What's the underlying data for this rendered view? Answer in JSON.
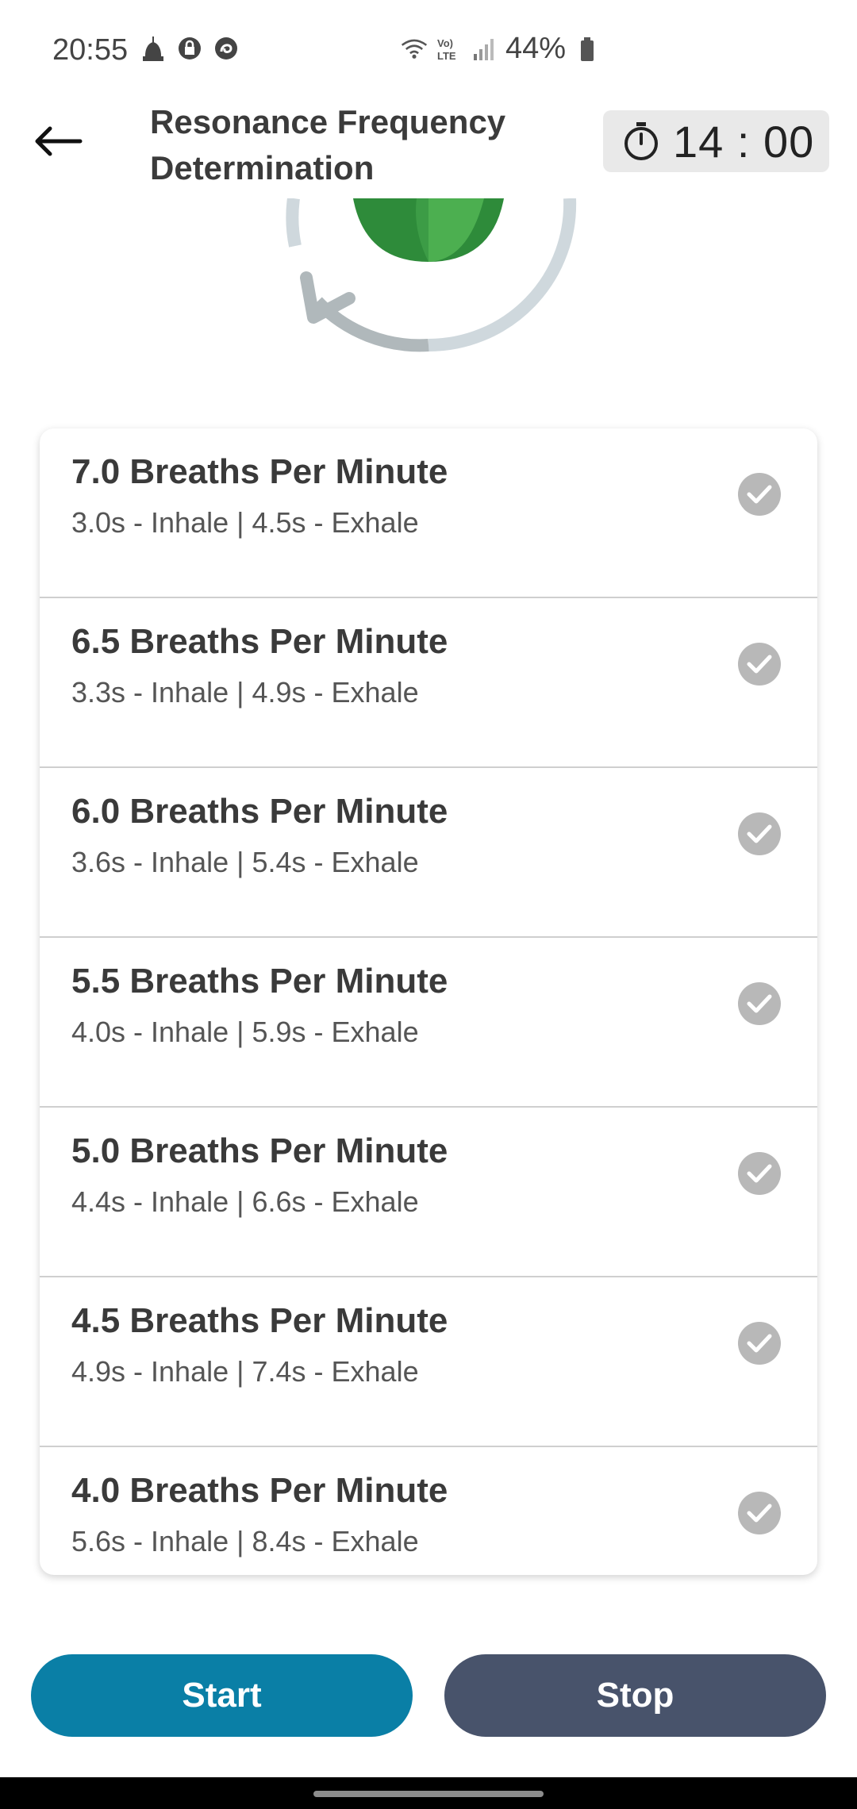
{
  "status_bar": {
    "time": "20:55",
    "battery": "44%",
    "icons": [
      "notification-icon",
      "lock-icon",
      "app-icon",
      "wifi-icon",
      "volte-icon",
      "signal-icon",
      "battery-icon"
    ]
  },
  "header": {
    "title": "Resonance Frequency Determination",
    "timer": "14 : 00"
  },
  "list": {
    "items": [
      {
        "title": "7.0 Breaths Per Minute",
        "subtitle": "3.0s - Inhale | 4.5s - Exhale"
      },
      {
        "title": "6.5 Breaths Per Minute",
        "subtitle": "3.3s - Inhale | 4.9s - Exhale"
      },
      {
        "title": "6.0 Breaths Per Minute",
        "subtitle": "3.6s - Inhale | 5.4s - Exhale"
      },
      {
        "title": "5.5 Breaths Per Minute",
        "subtitle": "4.0s - Inhale | 5.9s - Exhale"
      },
      {
        "title": "5.0 Breaths Per Minute",
        "subtitle": "4.4s - Inhale | 6.6s - Exhale"
      },
      {
        "title": "4.5 Breaths Per Minute",
        "subtitle": "4.9s - Inhale | 7.4s - Exhale"
      },
      {
        "title": "4.0 Breaths Per Minute",
        "subtitle": "5.6s - Inhale | 8.4s - Exhale"
      }
    ]
  },
  "buttons": {
    "start": "Start",
    "stop": "Stop"
  },
  "colors": {
    "start": "#0a7fa6",
    "stop": "#48536b",
    "check": "#b8b8b8",
    "leaf_dark": "#2e8b3a",
    "leaf_light": "#4caf50"
  }
}
